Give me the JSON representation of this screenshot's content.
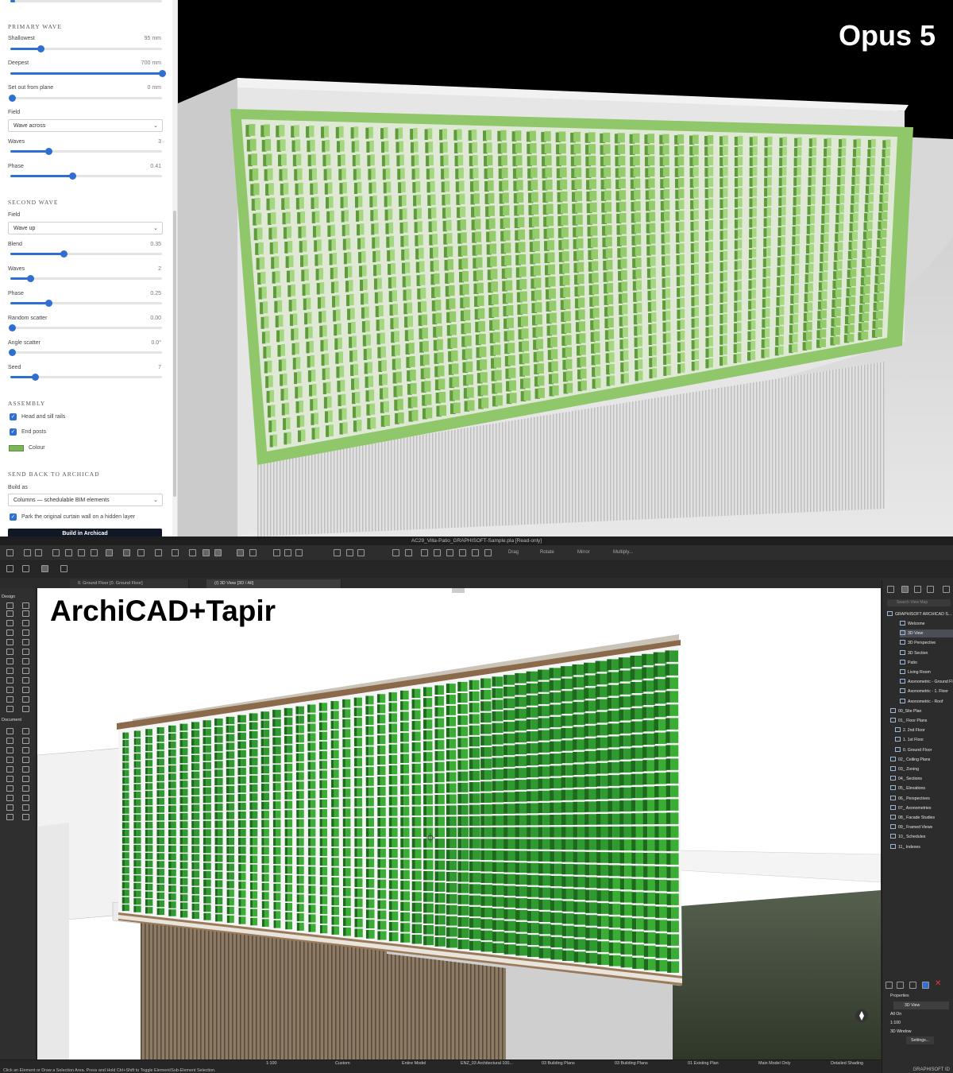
{
  "overlay": {
    "top_title": "Opus 5",
    "bottom_title": "ArchiCAD+Tapir"
  },
  "opus_panel": {
    "primary_wave": {
      "heading": "PRIMARY WAVE",
      "shallowest": {
        "label": "Shallowest",
        "value": "95 mm",
        "level": 0.2
      },
      "deepest": {
        "label": "Deepest",
        "value": "700 mm",
        "level": 1.0
      },
      "setout": {
        "label": "Set out from plane",
        "value": "0 mm",
        "level": 0.0
      },
      "field": {
        "label": "Field",
        "selected": "Wave across"
      },
      "waves": {
        "label": "Waves",
        "value": "3",
        "level": 0.25
      },
      "phase": {
        "label": "Phase",
        "value": "0.41",
        "level": 0.41
      }
    },
    "second_wave": {
      "heading": "SECOND WAVE",
      "field": {
        "label": "Field",
        "selected": "Wave up"
      },
      "blend": {
        "label": "Blend",
        "value": "0.35",
        "level": 0.35
      },
      "waves": {
        "label": "Waves",
        "value": "2",
        "level": 0.13
      },
      "phase": {
        "label": "Phase",
        "value": "0.25",
        "level": 0.25
      },
      "random_scatter": {
        "label": "Random scatter",
        "value": "0.00",
        "level": 0.0
      },
      "angle_scatter": {
        "label": "Angle scatter",
        "value": "0.0°",
        "level": 0.0
      },
      "seed": {
        "label": "Seed",
        "value": "7",
        "level": 0.16
      }
    },
    "assembly": {
      "heading": "ASSEMBLY",
      "head_sill": "Head and sill rails",
      "end_posts": "End posts",
      "colour": "Colour",
      "colour_hex": "#7cb55a"
    },
    "send_back": {
      "heading": "SEND BACK TO ARCHICAD",
      "build_as_label": "Build as",
      "build_as_selected": "Columns — schedulable BIM elements",
      "park": "Park the original curtain wall on a hidden layer",
      "build_button": "Build in Archicad"
    }
  },
  "archicad": {
    "window_title": "AC29_Villa-Patio_GRAPHISOFT-Sample.pla [Read-only]",
    "toolbar_labels": {
      "drag": "Drag",
      "rotate": "Rotate",
      "mirror": "Mirror",
      "multiply": "Multiply..."
    },
    "tabs": [
      "0. Ground Floor [0. Ground Floor]",
      "(/) 3D View [3D / All]"
    ],
    "toolbox": {
      "design": "Design",
      "document": "Document"
    },
    "navigator": {
      "search_placeholder": "Search View Map",
      "root": "GRAPHISOFT ARCHICAD S...",
      "items": [
        "Welcome",
        "3D View",
        "3D Perspective",
        "3D Section",
        "Patio",
        "Living Room",
        "Axonometric - Ground Fl...",
        "Axonometric - 1. Floor",
        "Axonometric - Roof",
        "00_Site Plan",
        "01_ Floor Plans",
        "2. 2nd Floor",
        "1. 1st Floor",
        "0. Ground Floor",
        "02_ Ceiling Plans",
        "03_ Zoning",
        "04_ Sections",
        "05_ Elevations",
        "06_ Perspectives",
        "07_ Axonometries",
        "08_ Facade Studies",
        "09_ Framed Views",
        "10_ Schedules",
        "11_ Indexes"
      ],
      "properties_heading": "Properties",
      "properties": [
        "3D View",
        "All On",
        "1:100",
        "3D Window"
      ],
      "settings": "Settings..."
    },
    "status": {
      "scale": "1:100",
      "custom": "Custom",
      "model": "Entire Model",
      "pen": "ENZ_03 Architectural 100...",
      "layers1": "03 Building Plans",
      "layers2": "03 Building Plans",
      "existing": "01 Existing Plan",
      "model_only": "Main Model Only",
      "shading": "Detailed Shading",
      "hint": "Click an Element or Draw a Selection Area. Press and Hold Ctrl+Shift to Toggle Element/Sub-Element Selection.",
      "brand": "GRAPHISOFT ID"
    }
  }
}
